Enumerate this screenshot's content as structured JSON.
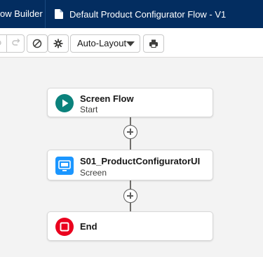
{
  "header": {
    "app_name": "ow Builder",
    "flow_title": "Default Product Configurator Flow - V1",
    "icons": {
      "flow_tab": "document-icon"
    }
  },
  "toolbar": {
    "buttons": [
      "undo-icon",
      "redo-icon",
      "disable-icon",
      "settings-icon",
      "print-icon"
    ],
    "layout_select": {
      "value": "Auto-Layout"
    }
  },
  "canvas": {
    "nodes": [
      {
        "title": "Screen Flow",
        "subtitle": "Start",
        "icon": "play-icon",
        "color": "#0b827c"
      },
      {
        "title": "S01_ProductConfiguratorUI",
        "subtitle": "Screen",
        "icon": "screen-icon",
        "color": "#1b96ff"
      },
      {
        "title": "End",
        "subtitle": "",
        "icon": "stop-icon",
        "color": "#ea001e"
      }
    ]
  },
  "colors": {
    "header_bg": "#032d60",
    "canvas_bg": "#f3f3f3",
    "connector": "#706e6b"
  }
}
